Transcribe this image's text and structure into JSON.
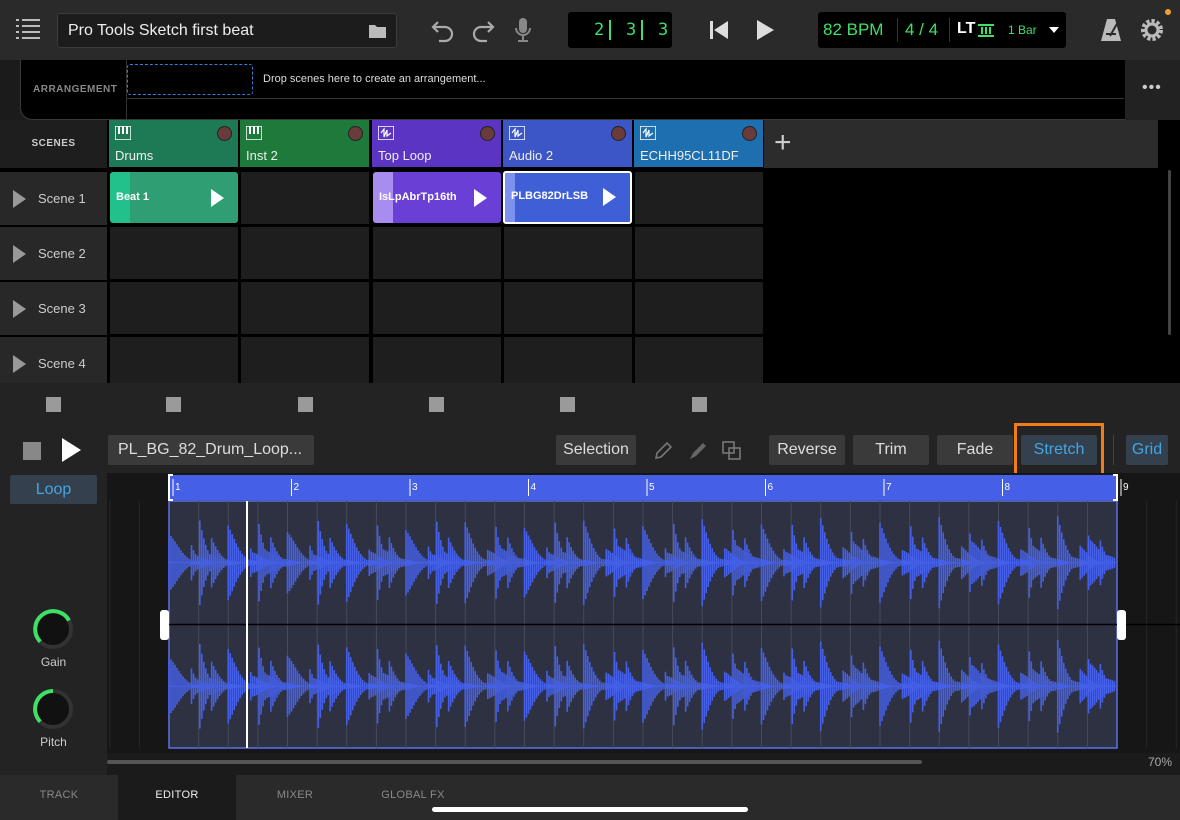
{
  "toolbar": {
    "project_name": "Pro Tools Sketch first beat",
    "counter": {
      "bar": "2",
      "beat": "3",
      "tick": "3"
    },
    "tempo": "82  BPM",
    "time_signature": "4 / 4",
    "lt_label": "LT",
    "bar_mode": "1 Bar",
    "notification_color": "#f0a030"
  },
  "arrangement": {
    "label": "ARRANGEMENT",
    "drop_hint": "Drop scenes here to create an arrangement...",
    "more_label": "•••"
  },
  "scenes": {
    "label": "SCENES",
    "add_label": "+",
    "rows": [
      {
        "label": "Scene 1"
      },
      {
        "label": "Scene 2"
      },
      {
        "label": "Scene 3"
      },
      {
        "label": "Scene 4"
      }
    ],
    "tracks": [
      {
        "name": "Drums",
        "type": "instrument",
        "color": "#1e7a55"
      },
      {
        "name": "Inst 2",
        "type": "instrument",
        "color": "#1e7a3a"
      },
      {
        "name": "Top Loop",
        "type": "audio",
        "color": "#5b34c4"
      },
      {
        "name": "Audio 2",
        "type": "audio",
        "color": "#3c56c8"
      },
      {
        "name": "ECHH95CL11DF",
        "type": "audio",
        "color": "#1d6fb0"
      }
    ],
    "clips": [
      {
        "track": 0,
        "scene": 0,
        "name": "Beat 1",
        "color": "#2f9e72",
        "selected": false
      },
      {
        "track": 2,
        "scene": 0,
        "name": "IsLpAbrTp16th",
        "color": "#6a3fd6",
        "selected": false
      },
      {
        "track": 3,
        "scene": 0,
        "name": "PLBG82DrLSB",
        "color": "#3f5fd6",
        "selected": true
      }
    ]
  },
  "editor": {
    "clip_name": "PL_BG_82_Drum_Loop...",
    "tools": {
      "selection": "Selection",
      "reverse": "Reverse",
      "trim": "Trim",
      "fade": "Fade",
      "stretch": "Stretch",
      "grid": "Grid"
    },
    "active_tool": "Stretch",
    "loop_label": "Loop",
    "knobs": [
      {
        "label": "Gain",
        "value": 0.85
      },
      {
        "label": "Pitch",
        "value": 0.5
      }
    ],
    "ruler": [
      "1",
      "2",
      "3",
      "4",
      "5",
      "6",
      "7",
      "8",
      "9"
    ],
    "zoom": "70%",
    "highlight_color": "#f07d1a",
    "wave_color": "#4560e6"
  },
  "tabs": [
    {
      "label": "TRACK",
      "active": false
    },
    {
      "label": "EDITOR",
      "active": true
    },
    {
      "label": "MIXER",
      "active": false
    },
    {
      "label": "GLOBAL FX",
      "active": false
    }
  ]
}
